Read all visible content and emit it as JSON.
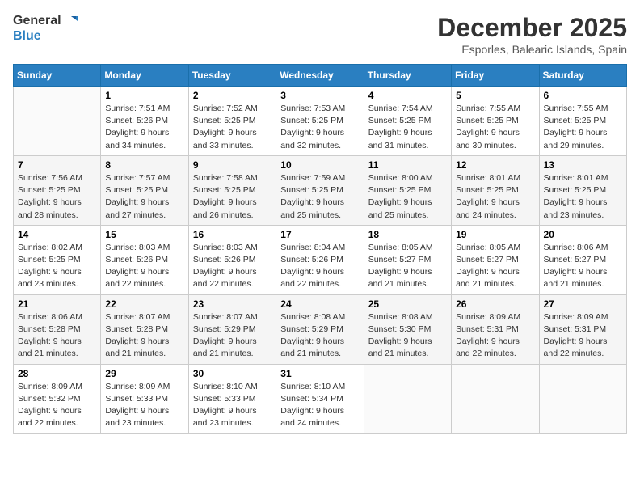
{
  "logo": {
    "line1": "General",
    "line2": "Blue"
  },
  "title": "December 2025",
  "subtitle": "Esporles, Balearic Islands, Spain",
  "days_of_week": [
    "Sunday",
    "Monday",
    "Tuesday",
    "Wednesday",
    "Thursday",
    "Friday",
    "Saturday"
  ],
  "weeks": [
    [
      {
        "day": null,
        "info": null
      },
      {
        "day": "1",
        "info": "Sunrise: 7:51 AM\nSunset: 5:26 PM\nDaylight: 9 hours\nand 34 minutes."
      },
      {
        "day": "2",
        "info": "Sunrise: 7:52 AM\nSunset: 5:25 PM\nDaylight: 9 hours\nand 33 minutes."
      },
      {
        "day": "3",
        "info": "Sunrise: 7:53 AM\nSunset: 5:25 PM\nDaylight: 9 hours\nand 32 minutes."
      },
      {
        "day": "4",
        "info": "Sunrise: 7:54 AM\nSunset: 5:25 PM\nDaylight: 9 hours\nand 31 minutes."
      },
      {
        "day": "5",
        "info": "Sunrise: 7:55 AM\nSunset: 5:25 PM\nDaylight: 9 hours\nand 30 minutes."
      },
      {
        "day": "6",
        "info": "Sunrise: 7:55 AM\nSunset: 5:25 PM\nDaylight: 9 hours\nand 29 minutes."
      }
    ],
    [
      {
        "day": "7",
        "info": "Sunrise: 7:56 AM\nSunset: 5:25 PM\nDaylight: 9 hours\nand 28 minutes."
      },
      {
        "day": "8",
        "info": "Sunrise: 7:57 AM\nSunset: 5:25 PM\nDaylight: 9 hours\nand 27 minutes."
      },
      {
        "day": "9",
        "info": "Sunrise: 7:58 AM\nSunset: 5:25 PM\nDaylight: 9 hours\nand 26 minutes."
      },
      {
        "day": "10",
        "info": "Sunrise: 7:59 AM\nSunset: 5:25 PM\nDaylight: 9 hours\nand 25 minutes."
      },
      {
        "day": "11",
        "info": "Sunrise: 8:00 AM\nSunset: 5:25 PM\nDaylight: 9 hours\nand 25 minutes."
      },
      {
        "day": "12",
        "info": "Sunrise: 8:01 AM\nSunset: 5:25 PM\nDaylight: 9 hours\nand 24 minutes."
      },
      {
        "day": "13",
        "info": "Sunrise: 8:01 AM\nSunset: 5:25 PM\nDaylight: 9 hours\nand 23 minutes."
      }
    ],
    [
      {
        "day": "14",
        "info": "Sunrise: 8:02 AM\nSunset: 5:25 PM\nDaylight: 9 hours\nand 23 minutes."
      },
      {
        "day": "15",
        "info": "Sunrise: 8:03 AM\nSunset: 5:26 PM\nDaylight: 9 hours\nand 22 minutes."
      },
      {
        "day": "16",
        "info": "Sunrise: 8:03 AM\nSunset: 5:26 PM\nDaylight: 9 hours\nand 22 minutes."
      },
      {
        "day": "17",
        "info": "Sunrise: 8:04 AM\nSunset: 5:26 PM\nDaylight: 9 hours\nand 22 minutes."
      },
      {
        "day": "18",
        "info": "Sunrise: 8:05 AM\nSunset: 5:27 PM\nDaylight: 9 hours\nand 21 minutes."
      },
      {
        "day": "19",
        "info": "Sunrise: 8:05 AM\nSunset: 5:27 PM\nDaylight: 9 hours\nand 21 minutes."
      },
      {
        "day": "20",
        "info": "Sunrise: 8:06 AM\nSunset: 5:27 PM\nDaylight: 9 hours\nand 21 minutes."
      }
    ],
    [
      {
        "day": "21",
        "info": "Sunrise: 8:06 AM\nSunset: 5:28 PM\nDaylight: 9 hours\nand 21 minutes."
      },
      {
        "day": "22",
        "info": "Sunrise: 8:07 AM\nSunset: 5:28 PM\nDaylight: 9 hours\nand 21 minutes."
      },
      {
        "day": "23",
        "info": "Sunrise: 8:07 AM\nSunset: 5:29 PM\nDaylight: 9 hours\nand 21 minutes."
      },
      {
        "day": "24",
        "info": "Sunrise: 8:08 AM\nSunset: 5:29 PM\nDaylight: 9 hours\nand 21 minutes."
      },
      {
        "day": "25",
        "info": "Sunrise: 8:08 AM\nSunset: 5:30 PM\nDaylight: 9 hours\nand 21 minutes."
      },
      {
        "day": "26",
        "info": "Sunrise: 8:09 AM\nSunset: 5:31 PM\nDaylight: 9 hours\nand 22 minutes."
      },
      {
        "day": "27",
        "info": "Sunrise: 8:09 AM\nSunset: 5:31 PM\nDaylight: 9 hours\nand 22 minutes."
      }
    ],
    [
      {
        "day": "28",
        "info": "Sunrise: 8:09 AM\nSunset: 5:32 PM\nDaylight: 9 hours\nand 22 minutes."
      },
      {
        "day": "29",
        "info": "Sunrise: 8:09 AM\nSunset: 5:33 PM\nDaylight: 9 hours\nand 23 minutes."
      },
      {
        "day": "30",
        "info": "Sunrise: 8:10 AM\nSunset: 5:33 PM\nDaylight: 9 hours\nand 23 minutes."
      },
      {
        "day": "31",
        "info": "Sunrise: 8:10 AM\nSunset: 5:34 PM\nDaylight: 9 hours\nand 24 minutes."
      },
      {
        "day": null,
        "info": null
      },
      {
        "day": null,
        "info": null
      },
      {
        "day": null,
        "info": null
      }
    ]
  ]
}
